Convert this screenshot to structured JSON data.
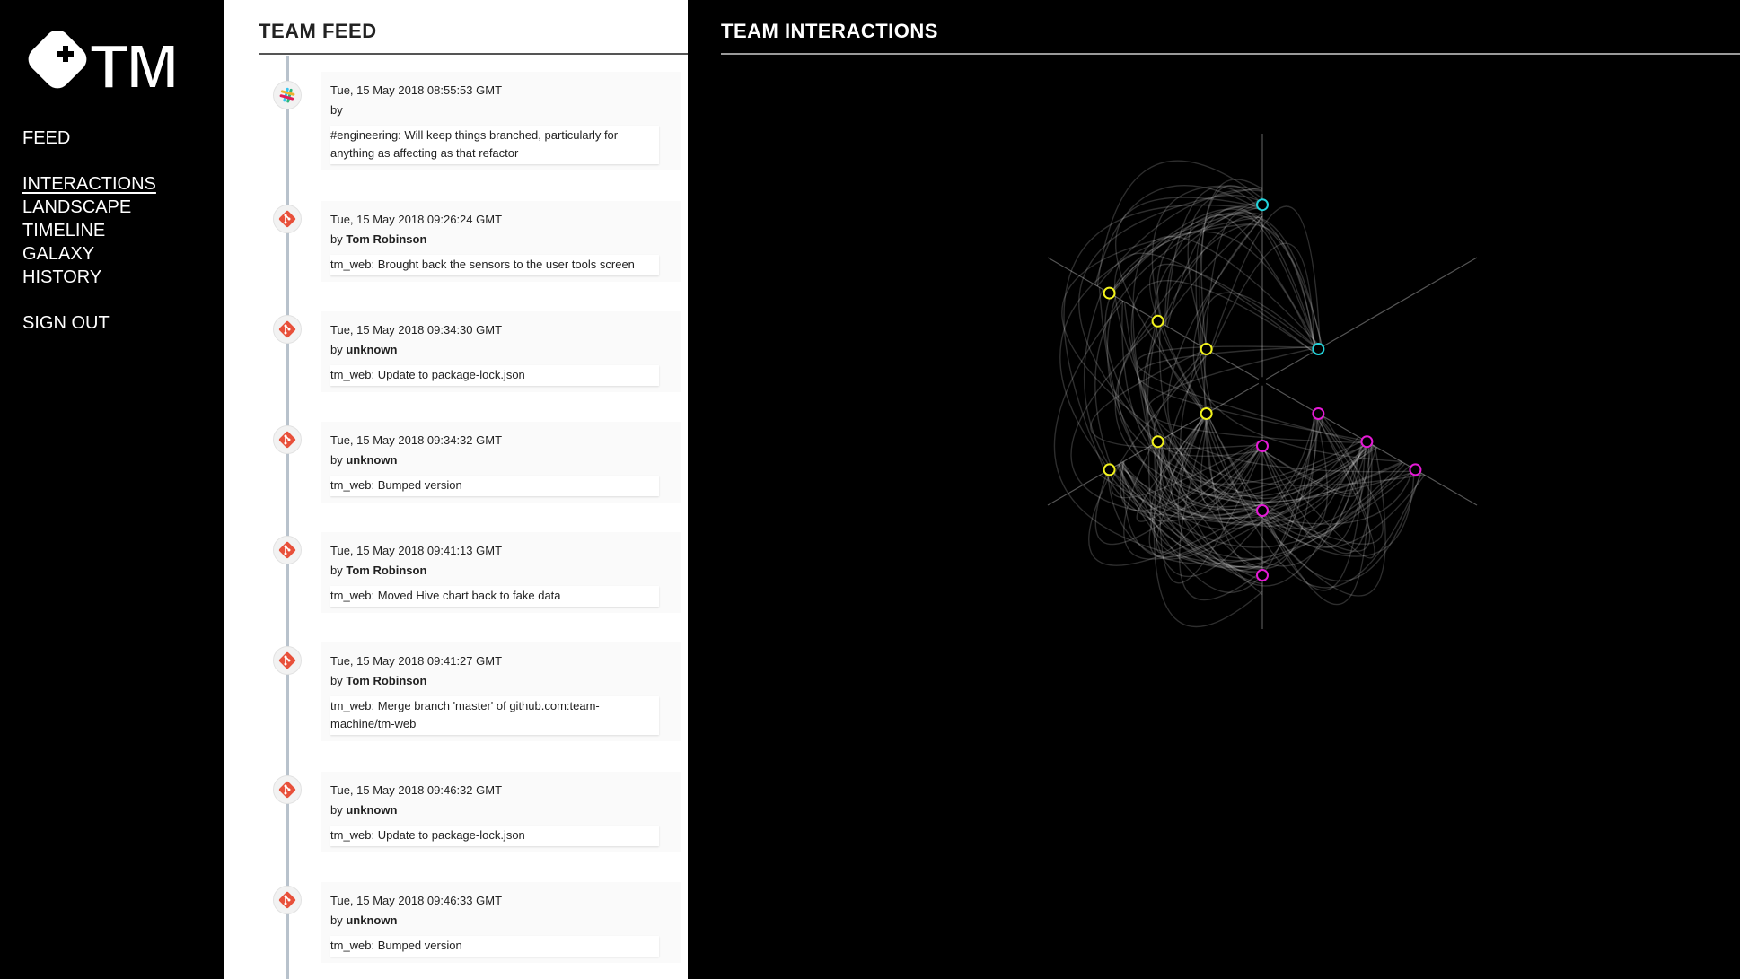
{
  "app": {
    "logo_text": "TM"
  },
  "nav": {
    "feed": "FEED",
    "interactions": "INTERACTIONS",
    "landscape": "LANDSCAPE",
    "timeline": "TIMELINE",
    "galaxy": "GALAXY",
    "history": "HISTORY",
    "sign_out": "SIGN OUT",
    "active": "interactions"
  },
  "feed": {
    "title": "TEAM FEED",
    "entries": [
      {
        "source": "slack-icon",
        "timestamp": "Tue, 15 May 2018 08:55:53 GMT",
        "by_label": "by",
        "author": "",
        "message": "#engineering: Will keep things branched, particularly for anything as affecting as that refactor"
      },
      {
        "source": "git-icon",
        "timestamp": "Tue, 15 May 2018 09:26:24 GMT",
        "by_label": "by",
        "author": "Tom Robinson",
        "message": "tm_web: Brought back the sensors to the user tools screen"
      },
      {
        "source": "git-icon",
        "timestamp": "Tue, 15 May 2018 09:34:30 GMT",
        "by_label": "by",
        "author": "unknown",
        "message": "tm_web: Update to package-lock.json"
      },
      {
        "source": "git-icon",
        "timestamp": "Tue, 15 May 2018 09:34:32 GMT",
        "by_label": "by",
        "author": "unknown",
        "message": "tm_web: Bumped version"
      },
      {
        "source": "git-icon",
        "timestamp": "Tue, 15 May 2018 09:41:13 GMT",
        "by_label": "by",
        "author": "Tom Robinson",
        "message": "tm_web: Moved Hive chart back to fake data"
      },
      {
        "source": "git-icon",
        "timestamp": "Tue, 15 May 2018 09:41:27 GMT",
        "by_label": "by",
        "author": "Tom Robinson",
        "message": "tm_web: Merge branch 'master' of github.com:team-machine/tm-web"
      },
      {
        "source": "git-icon",
        "timestamp": "Tue, 15 May 2018 09:46:32 GMT",
        "by_label": "by",
        "author": "unknown",
        "message": "tm_web: Update to package-lock.json"
      },
      {
        "source": "git-icon",
        "timestamp": "Tue, 15 May 2018 09:46:33 GMT",
        "by_label": "by",
        "author": "unknown",
        "message": "tm_web: Bumped version"
      }
    ]
  },
  "interactions": {
    "title": "TEAM INTERACTIONS",
    "colors": {
      "group_a": "#f2f21c",
      "group_b": "#22d4dc",
      "group_c": "#e51ad6",
      "link": "#ffffff",
      "axis": "#555555"
    },
    "axes": [
      {
        "group": "group_a",
        "angle_deg": 210,
        "nodes": [
          0.3,
          0.56,
          0.82
        ]
      },
      {
        "group": "group_a",
        "angle_deg": 150,
        "nodes": [
          0.3,
          0.56,
          0.82
        ]
      },
      {
        "group": "group_b",
        "angle_deg": 90,
        "nodes": [
          0.82
        ]
      },
      {
        "group": "group_b",
        "angle_deg": 30,
        "nodes": [
          0.3
        ]
      },
      {
        "group": "group_c",
        "angle_deg": 330,
        "nodes": [
          0.3,
          0.56,
          0.82
        ]
      },
      {
        "group": "group_c",
        "angle_deg": 270,
        "nodes": [
          0.3,
          0.6,
          0.9
        ]
      }
    ]
  }
}
